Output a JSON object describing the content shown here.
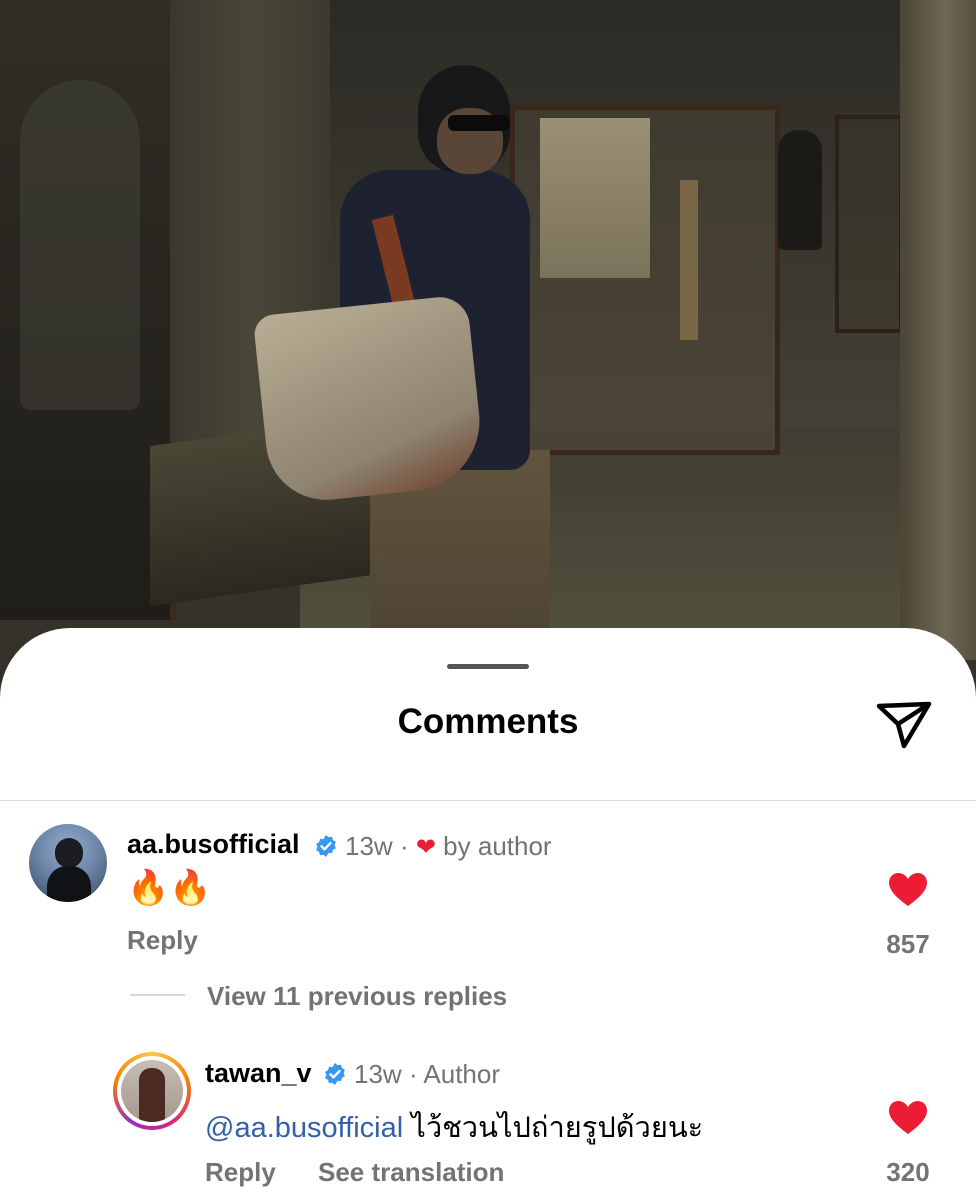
{
  "sheet": {
    "title": "Comments",
    "share_icon": "send-icon"
  },
  "comments": [
    {
      "username": "aa.busofficial",
      "verified": true,
      "time": "13w",
      "liked_by_author_label": "by author",
      "text": "🔥🔥",
      "reply_label": "Reply",
      "likes": "857",
      "liked": true
    }
  ],
  "view_replies_label": "View 11 previous replies",
  "reply": {
    "username": "tawan_v",
    "verified": true,
    "time": "13w",
    "role": "Author",
    "mention": "@aa.busofficial",
    "text": "ไว้ชวนไปถ่ายรูปด้วยนะ",
    "reply_label": "Reply",
    "translate_label": "See translation",
    "likes": "320",
    "liked": true
  },
  "colors": {
    "like_red": "#ed1c35",
    "verified_blue": "#3897f0",
    "mention_blue": "#3460a8",
    "muted": "#737373"
  }
}
